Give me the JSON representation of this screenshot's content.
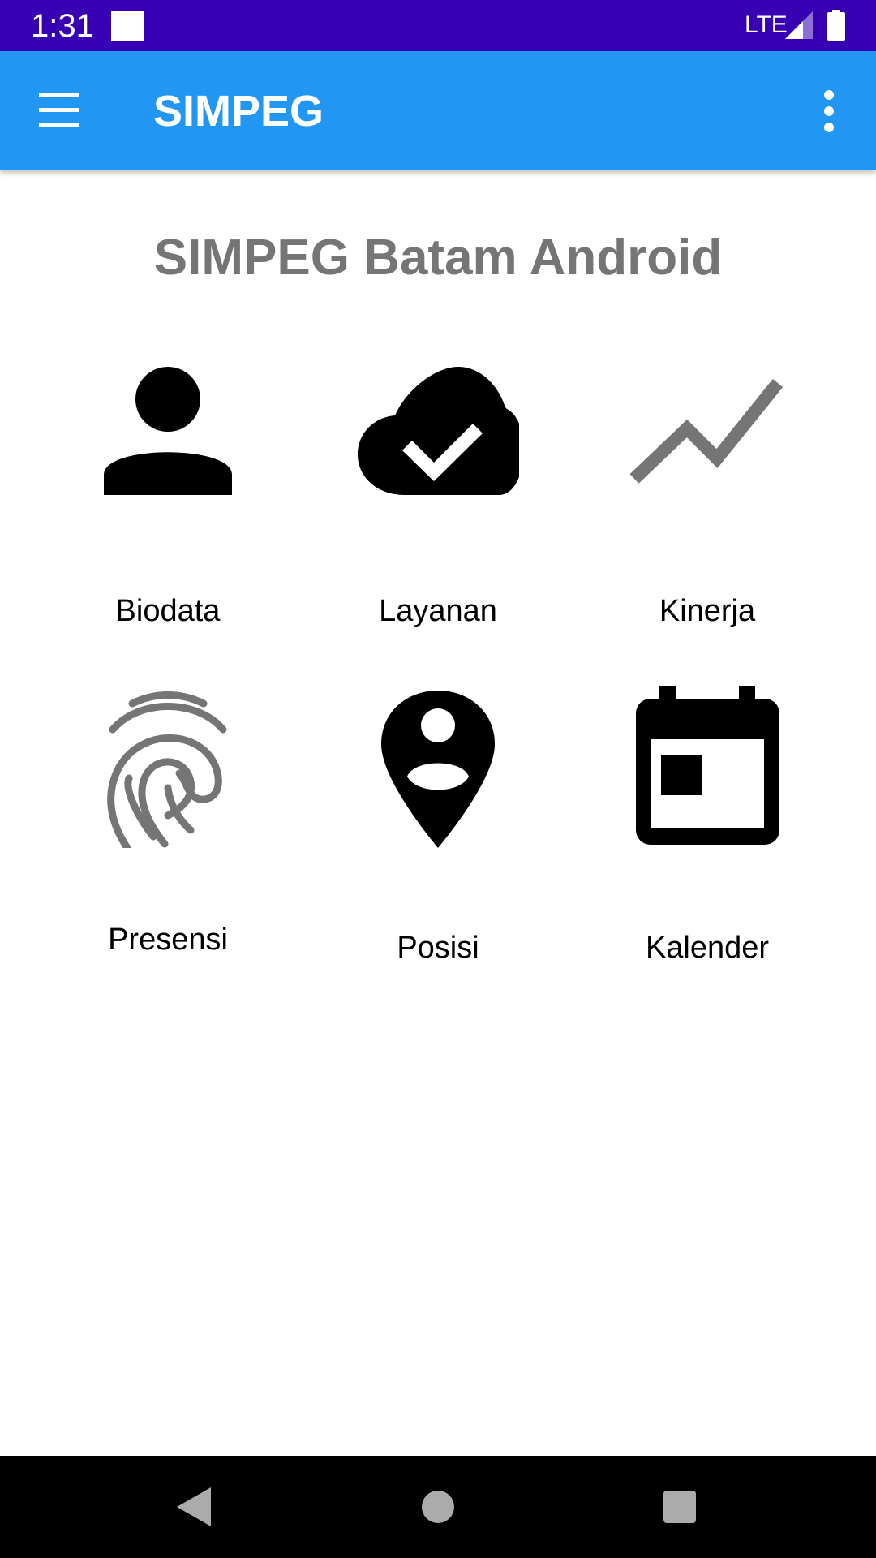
{
  "status_bar": {
    "time": "1:31",
    "network": "LTE",
    "icons": [
      "notification-icon",
      "signal-icon",
      "battery-icon"
    ]
  },
  "app_bar": {
    "title": "SIMPEG",
    "menu_icon": "hamburger-menu-icon",
    "overflow_icon": "more-vert-icon",
    "color": "#2196F3"
  },
  "main": {
    "heading": "SIMPEG Batam Android",
    "tiles": [
      {
        "label": "Biodata",
        "icon": "person-icon"
      },
      {
        "label": "Layanan",
        "icon": "cloud-done-icon"
      },
      {
        "label": "Kinerja",
        "icon": "trending-icon"
      },
      {
        "label": "Presensi",
        "icon": "fingerprint-icon"
      },
      {
        "label": "Posisi",
        "icon": "person-pin-icon"
      },
      {
        "label": "Kalender",
        "icon": "calendar-icon"
      }
    ]
  },
  "nav_bar": {
    "buttons": [
      "back-icon",
      "home-icon",
      "recents-icon"
    ]
  },
  "colors": {
    "status_bar": "#3700B3",
    "app_bar": "#2196F3",
    "heading": "#757575",
    "icon_dark": "#000000",
    "icon_gray": "#757575"
  }
}
